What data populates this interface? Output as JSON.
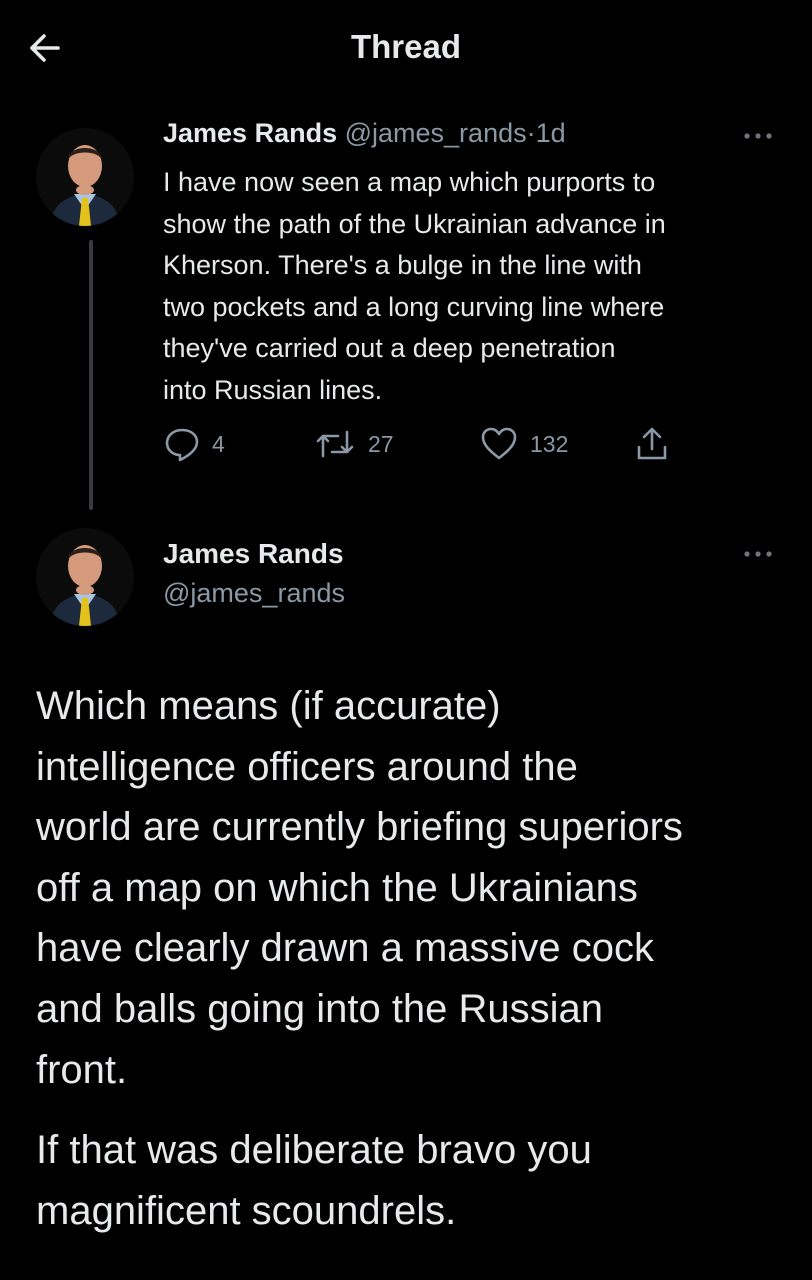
{
  "header": {
    "title": "Thread",
    "back_icon": "arrow-left-icon"
  },
  "colors": {
    "background": "#000000",
    "text": "#e7e9ea",
    "muted": "#8b98a5",
    "thread_line": "#3a3d40"
  },
  "tweet1": {
    "author_name": "James Rands",
    "handle": "@james_rands",
    "separator": "·",
    "time": "1d",
    "body_lines": [
      "I have now seen a map which purports to",
      "show the path of the Ukrainian advance in",
      "Kherson. There's a bulge in the line with",
      "two pockets and a long curving line where",
      "they've carried out a deep penetration",
      "into Russian lines."
    ],
    "replies": "4",
    "retweets": "27",
    "likes": "132"
  },
  "tweet2": {
    "author_name": "James Rands",
    "handle": "@james_rands",
    "paragraph1_lines": [
      "Which means (if accurate)",
      "intelligence officers around the",
      "world are currently briefing superiors",
      "off a map on which the Ukrainians",
      "have clearly drawn a massive cock",
      "and balls going into the Russian",
      "front."
    ],
    "paragraph2_lines": [
      "If that was deliberate bravo you",
      "magnificent scoundrels."
    ]
  }
}
